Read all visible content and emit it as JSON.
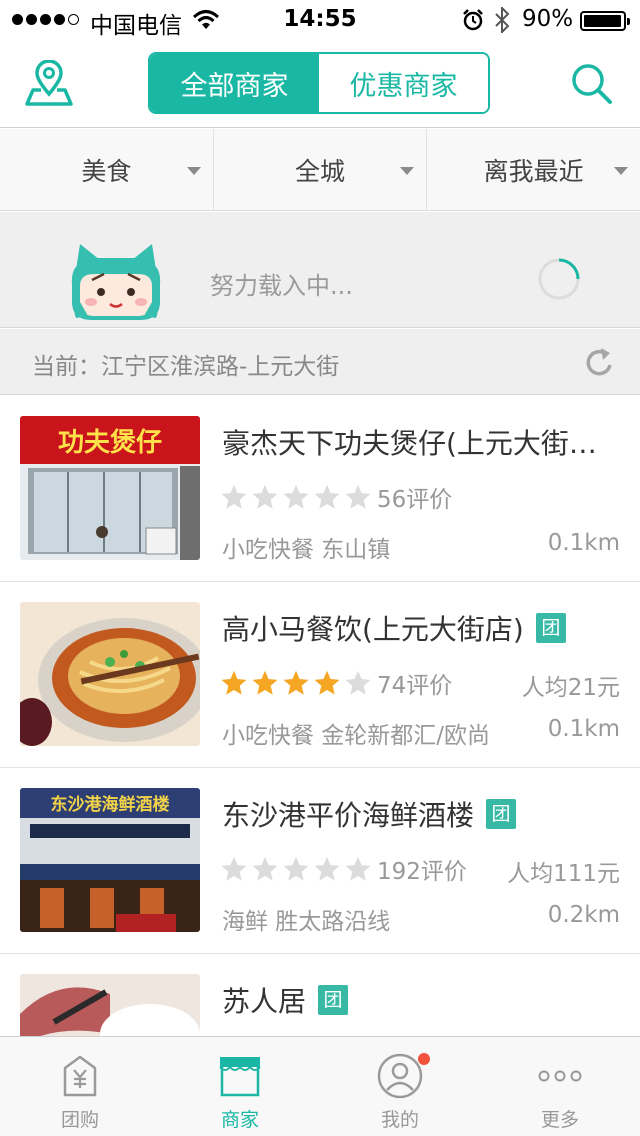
{
  "status_bar": {
    "carrier": "中国电信",
    "time": "14:55",
    "battery": "90%"
  },
  "nav": {
    "segments": [
      {
        "label": "全部商家",
        "active": true
      },
      {
        "label": "优惠商家",
        "active": false
      }
    ],
    "icons": {
      "left": "location-pin-icon",
      "right": "search-icon"
    },
    "accent": "#1ab8a4"
  },
  "filters": [
    {
      "label": "美食"
    },
    {
      "label": "全城"
    },
    {
      "label": "离我最近"
    }
  ],
  "loading": {
    "text": "努力载入中..."
  },
  "current": {
    "text": "当前：江宁区淮滨路-上元大街"
  },
  "merchants": [
    {
      "name": "豪杰天下功夫煲仔(上元大街…",
      "tuan": false,
      "rating": 0,
      "reviews": "56评价",
      "avg": "",
      "category_area": "小吃快餐 东山镇",
      "distance": "0.1km",
      "sign_text": "功夫煲仔"
    },
    {
      "name": "高小马餐饮(上元大街店)",
      "tuan": true,
      "rating": 4,
      "reviews": "74评价",
      "avg": "人均21元",
      "category_area": "小吃快餐 金轮新都汇/欧尚",
      "distance": "0.1km"
    },
    {
      "name": "东沙港平价海鲜酒楼",
      "tuan": true,
      "rating": 0,
      "reviews": "192评价",
      "avg": "人均111元",
      "category_area": "海鲜 胜太路沿线",
      "distance": "0.2km",
      "sign_text": "东沙港海鲜酒楼"
    },
    {
      "name": "苏人居",
      "tuan": true,
      "rating": 0,
      "reviews": "",
      "avg": "",
      "category_area": "",
      "distance": ""
    }
  ],
  "tuan_label": "团",
  "tabbar": [
    {
      "label": "团购",
      "icon": "group-buy-icon",
      "active": false
    },
    {
      "label": "商家",
      "icon": "store-icon",
      "active": true
    },
    {
      "label": "我的",
      "icon": "profile-icon",
      "active": false,
      "badge": true
    },
    {
      "label": "更多",
      "icon": "more-icon",
      "active": false
    }
  ]
}
